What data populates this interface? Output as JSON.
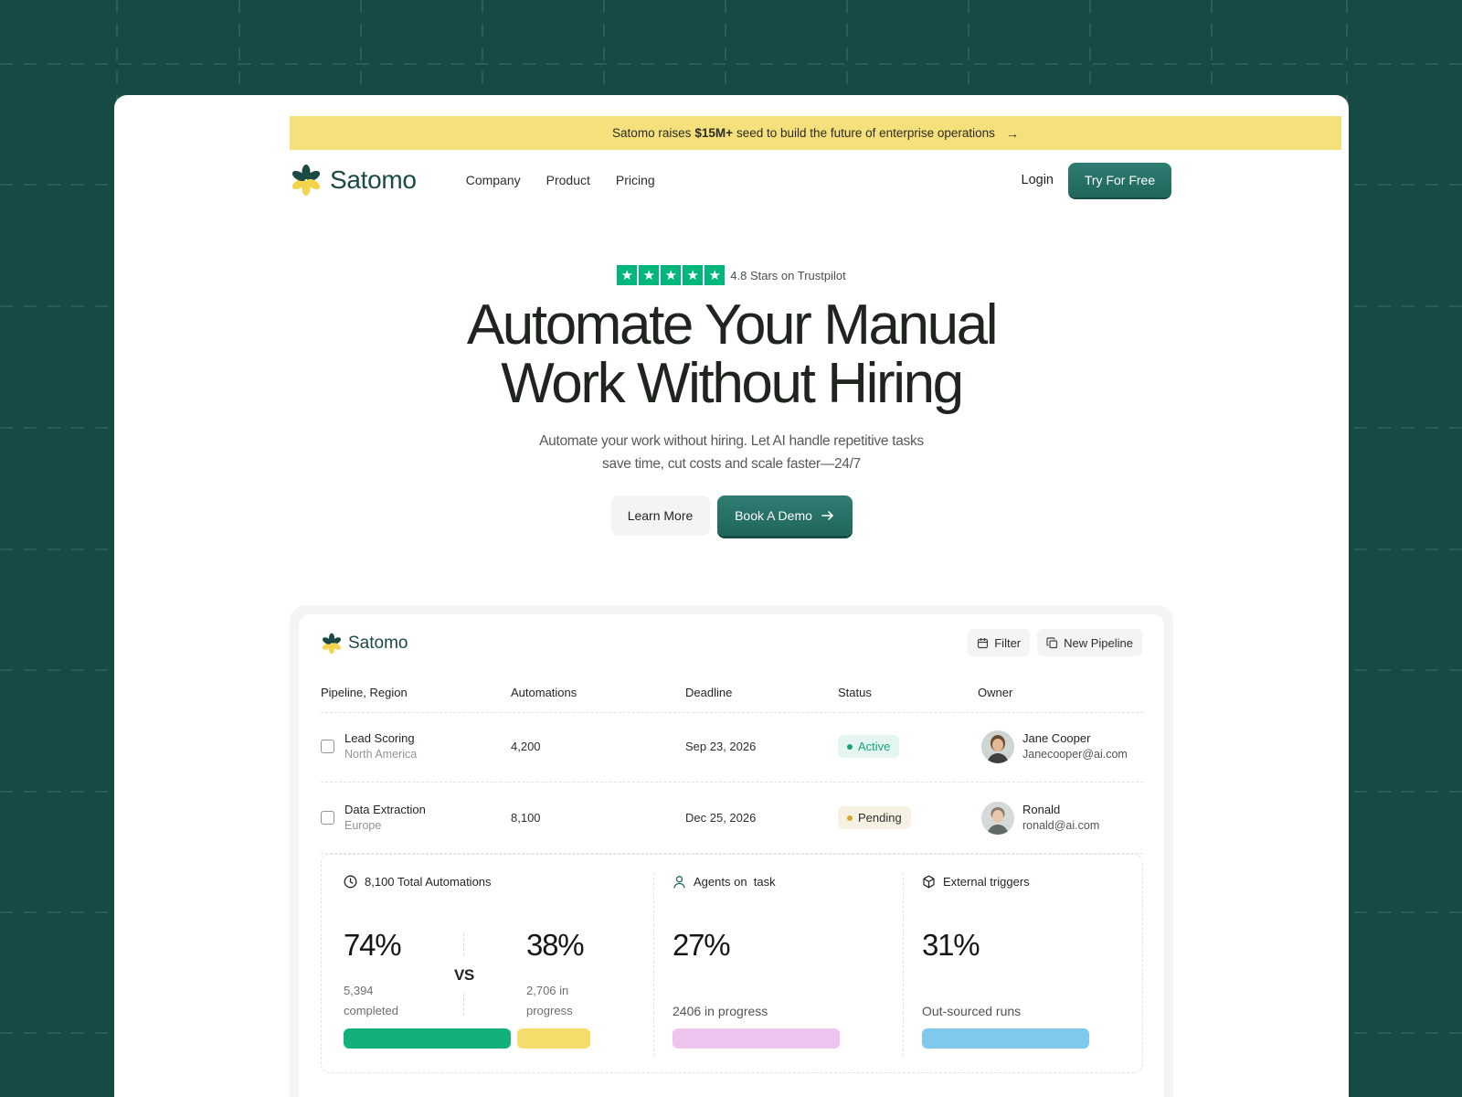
{
  "banner": {
    "text_before": "Satomo raises",
    "amount": "$15M+",
    "text_after": "seed to build the future of enterprise operations",
    "arrow": "→"
  },
  "nav": {
    "logo_text": "Satomo",
    "links": [
      "Company",
      "Product",
      "Pricing"
    ],
    "login": "Login",
    "cta": "Try For Free"
  },
  "hero": {
    "rating_text": "4.8 Stars on Trustpilot",
    "stars": 5,
    "headline_line1": "Automate Your Manual",
    "headline_line2": "Work Without Hiring",
    "sub_line1": "Automate your work without hiring. Let AI handle repetitive tasks",
    "sub_line2": "save time, cut costs and scale faster—24/7",
    "learn_more": "Learn More",
    "book_demo": "Book A Demo"
  },
  "dashboard": {
    "logo_text": "Satomo",
    "filter": "Filter",
    "new_pipeline": "New Pipeline",
    "columns": [
      "Pipeline, Region",
      "Automations",
      "Deadline",
      "Status",
      "Owner"
    ],
    "rows": [
      {
        "name": "Lead Scoring",
        "region": "North America",
        "automations": "4,200",
        "deadline": "Sep 23, 2026",
        "status": "Active",
        "owner": "Jane Cooper",
        "email": "Janecooper@ai.com"
      },
      {
        "name": "Data Extraction",
        "region": "Europe",
        "automations": "8,100",
        "deadline": "Dec 25, 2026",
        "status": "Pending",
        "owner": "Ronald",
        "email": "ronald@ai.com"
      }
    ],
    "stats": {
      "total": {
        "label": "8,100 Total Automations",
        "left_pct": "74%",
        "left_line1": "5,394",
        "left_line2": "completed",
        "vs": "VS",
        "right_pct": "38%",
        "right_line1": "2,706 in",
        "right_line2": "progress"
      },
      "agents": {
        "label": "Agents on  task",
        "pct": "27%",
        "sub": "2406 in progress"
      },
      "external": {
        "label": "External triggers",
        "pct": "31%",
        "sub": "Out-sourced runs"
      }
    }
  },
  "colors": {
    "background": "#164a45",
    "accent": "#236f65",
    "banner": "#f6e07c",
    "active": "#18a37c",
    "pending": "#d6a829",
    "bar_completed": "#12b07a",
    "bar_progress": "#f6dc6b",
    "bar_agents": "#efc5ef",
    "bar_external": "#7fc9ec"
  }
}
